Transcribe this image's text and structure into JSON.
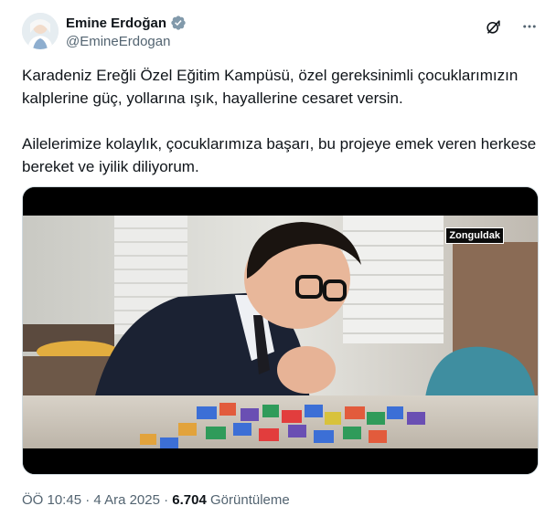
{
  "author": {
    "display_name": "Emine Erdoğan",
    "handle": "@EmineErdogan",
    "avatar_icon": "profile-photo",
    "verified_icon": "verified-badge-icon",
    "verified_color": "#829aab"
  },
  "header_actions": {
    "grok_icon": "grok-icon",
    "more_icon": "more-horizontal-icon"
  },
  "post": {
    "paragraphs": [
      "Karadeniz Ereğli Özel Eğitim Kampüsü, özel gereksinimli çocuklarımızın kalplerine güç, yollarına ışık, hayallerine cesaret versin.",
      "Ailelerimize kolaylık, çocuklarımıza başarı, bu projeye emek veren herkese bereket ve iyilik diliyorum."
    ]
  },
  "media": {
    "type": "video",
    "overlay_label": "Zonguldak"
  },
  "meta": {
    "time": "ÖÖ 10:45",
    "separator": "·",
    "date": "4 Ara 2025",
    "views_count": "6.704",
    "views_label": "Görüntüleme"
  },
  "colors": {
    "text_primary": "#0f1419",
    "text_secondary": "#536471"
  }
}
